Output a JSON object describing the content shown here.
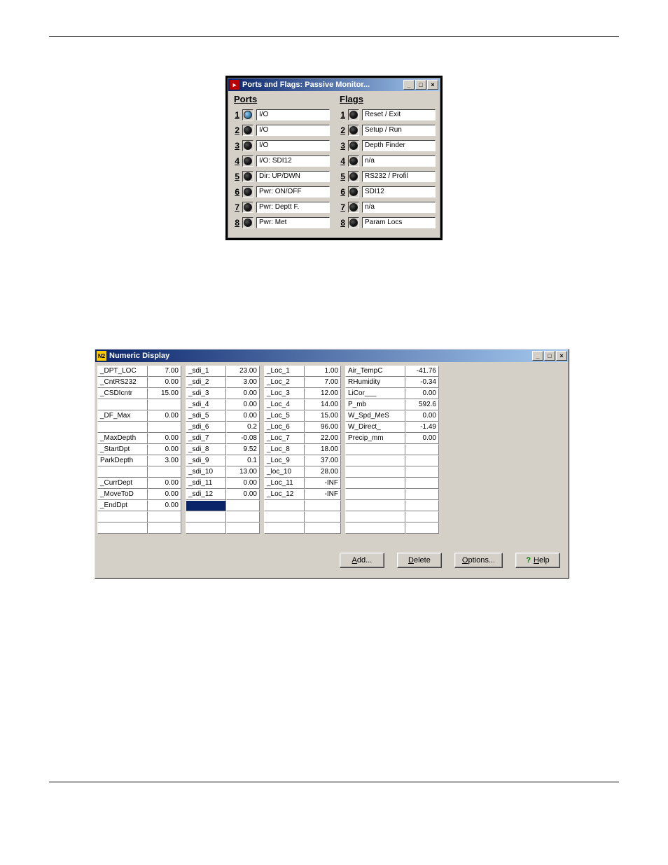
{
  "win1": {
    "title": "Ports and Flags: Passive Monitor...",
    "ports_header": "Ports",
    "flags_header": "Flags",
    "ports": [
      {
        "n": "1",
        "on": true,
        "label": "I/O"
      },
      {
        "n": "2",
        "on": false,
        "label": "I/O"
      },
      {
        "n": "3",
        "on": false,
        "label": "I/O"
      },
      {
        "n": "4",
        "on": false,
        "label": "I/O: SDI12"
      },
      {
        "n": "5",
        "on": false,
        "label": "Dir: UP/DWN"
      },
      {
        "n": "6",
        "on": false,
        "label": "Pwr: ON/OFF"
      },
      {
        "n": "7",
        "on": false,
        "label": "Pwr: Deptt F."
      },
      {
        "n": "8",
        "on": false,
        "label": "Pwr: Met"
      }
    ],
    "flags": [
      {
        "n": "1",
        "on": false,
        "label": "Reset / Exit"
      },
      {
        "n": "2",
        "on": false,
        "label": "Setup / Run"
      },
      {
        "n": "3",
        "on": false,
        "label": "Depth Finder"
      },
      {
        "n": "4",
        "on": false,
        "label": "n/a"
      },
      {
        "n": "5",
        "on": false,
        "label": "RS232 / Profil"
      },
      {
        "n": "6",
        "on": false,
        "label": "SDI12"
      },
      {
        "n": "7",
        "on": false,
        "label": "n/a"
      },
      {
        "n": "8",
        "on": false,
        "label": "Param Locs"
      }
    ]
  },
  "win2": {
    "title": "Numeric Display",
    "icon_text": "N2",
    "buttons": {
      "add": "Add...",
      "delete": "Delete",
      "options": "Options...",
      "help": "Help"
    },
    "col1": [
      {
        "name": "_DPT_LOC",
        "val": "7.00"
      },
      {
        "name": "_CntRS232",
        "val": "0.00"
      },
      {
        "name": "_CSDIcntr",
        "val": "15.00"
      },
      {
        "name": "",
        "val": ""
      },
      {
        "name": "_DF_Max",
        "val": "0.00"
      },
      {
        "name": "",
        "val": ""
      },
      {
        "name": "_MaxDepth",
        "val": "0.00"
      },
      {
        "name": "_StartDpt",
        "val": "0.00"
      },
      {
        "name": "ParkDepth",
        "val": "3.00"
      },
      {
        "name": "",
        "val": ""
      },
      {
        "name": "_CurrDept",
        "val": "0.00"
      },
      {
        "name": "_MoveToD",
        "val": "0.00"
      },
      {
        "name": "_EndDpt",
        "val": "0.00"
      },
      {
        "name": "",
        "val": ""
      },
      {
        "name": "",
        "val": ""
      }
    ],
    "col2": [
      {
        "name": "_sdi_1",
        "val": "23.00"
      },
      {
        "name": "_sdi_2",
        "val": "3.00"
      },
      {
        "name": "_sdi_3",
        "val": "0.00"
      },
      {
        "name": "_sdi_4",
        "val": "0.00"
      },
      {
        "name": "_sdi_5",
        "val": "0.00"
      },
      {
        "name": "_sdi_6",
        "val": "0.2"
      },
      {
        "name": "_sdi_7",
        "val": "-0.08"
      },
      {
        "name": "_sdi_8",
        "val": "9.52"
      },
      {
        "name": "_sdi_9",
        "val": "0.1"
      },
      {
        "name": "_sdi_10",
        "val": "13.00"
      },
      {
        "name": "_sdi_11",
        "val": "0.00"
      },
      {
        "name": "_sdi_12",
        "val": "0.00"
      },
      {
        "name": "",
        "val": "",
        "sel": true
      },
      {
        "name": "",
        "val": ""
      },
      {
        "name": "",
        "val": ""
      }
    ],
    "col3": [
      {
        "name": "_Loc_1",
        "val": "1.00"
      },
      {
        "name": "_Loc_2",
        "val": "7.00"
      },
      {
        "name": "_Loc_3",
        "val": "12.00"
      },
      {
        "name": "_Loc_4",
        "val": "14.00"
      },
      {
        "name": "_Loc_5",
        "val": "15.00"
      },
      {
        "name": "_Loc_6",
        "val": "96.00"
      },
      {
        "name": "_Loc_7",
        "val": "22.00"
      },
      {
        "name": "_Loc_8",
        "val": "18.00"
      },
      {
        "name": "_Loc_9",
        "val": "37.00"
      },
      {
        "name": "_loc_10",
        "val": "28.00"
      },
      {
        "name": "_Loc_11",
        "val": "-INF"
      },
      {
        "name": "_Loc_12",
        "val": "-INF"
      },
      {
        "name": "",
        "val": ""
      },
      {
        "name": "",
        "val": ""
      },
      {
        "name": "",
        "val": ""
      }
    ],
    "col4": [
      {
        "name": "Air_TempC",
        "val": "-41.76"
      },
      {
        "name": "RHumidity",
        "val": "-0.34"
      },
      {
        "name": "LiCor___",
        "val": "0.00"
      },
      {
        "name": "P_mb",
        "val": "592.6"
      },
      {
        "name": "W_Spd_MeS",
        "val": "0.00"
      },
      {
        "name": "W_Direct_",
        "val": "-1.49"
      },
      {
        "name": "Precip_mm",
        "val": "0.00"
      },
      {
        "name": "",
        "val": ""
      },
      {
        "name": "",
        "val": ""
      },
      {
        "name": "",
        "val": ""
      },
      {
        "name": "",
        "val": ""
      },
      {
        "name": "",
        "val": ""
      },
      {
        "name": "",
        "val": ""
      },
      {
        "name": "",
        "val": ""
      },
      {
        "name": "",
        "val": ""
      }
    ]
  }
}
